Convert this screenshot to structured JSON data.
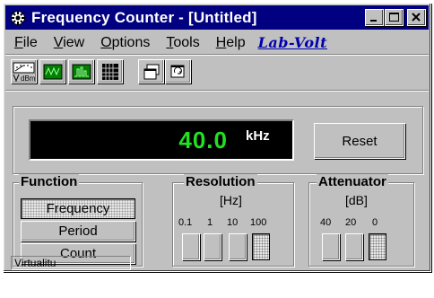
{
  "window": {
    "title": "Frequency Counter - [Untitled]",
    "title_bar_color": "#000080"
  },
  "title_icon": "gear-icon",
  "window_buttons": [
    "minimize-icon",
    "maximize-icon",
    "close-icon"
  ],
  "menu": [
    {
      "label": "File",
      "mnemonic": "F",
      "rest": "ile"
    },
    {
      "label": "View",
      "mnemonic": "V",
      "rest": "iew"
    },
    {
      "label": "Options",
      "mnemonic": "O",
      "rest": "ptions"
    },
    {
      "label": "Tools",
      "mnemonic": "T",
      "rest": "ools"
    },
    {
      "label": "Help",
      "mnemonic": "H",
      "rest": "elp"
    }
  ],
  "brand": "Lab-Volt",
  "toolbar": {
    "buttons": [
      {
        "name": "dbm-meter-button",
        "icon": "dbm-meter-icon",
        "label": "dBm"
      },
      {
        "name": "oscilloscope-button",
        "icon": "oscilloscope-icon"
      },
      {
        "name": "spectrum-analyzer-button",
        "icon": "spectrum-icon"
      },
      {
        "name": "table-button",
        "icon": "table-icon"
      },
      {
        "name": "copy-window-button",
        "icon": "copy-window-icon"
      },
      {
        "name": "refresh-window-button",
        "icon": "refresh-window-icon"
      }
    ]
  },
  "display": {
    "value": "40.0",
    "unit": "kHz",
    "value_color": "#22e022"
  },
  "reset_label": "Reset",
  "function": {
    "title": "Function",
    "buttons": [
      "Frequency",
      "Period",
      "Count"
    ],
    "selected": "Frequency"
  },
  "resolution": {
    "title": "Resolution",
    "unit": "[Hz]",
    "options": [
      "0.1",
      "1",
      "10",
      "100"
    ],
    "selected": "100"
  },
  "attenuator": {
    "title": "Attenuator",
    "unit": "[dB]",
    "options": [
      "40",
      "20",
      "0"
    ],
    "selected": "0"
  },
  "status": {
    "text": "Virtualitu"
  }
}
